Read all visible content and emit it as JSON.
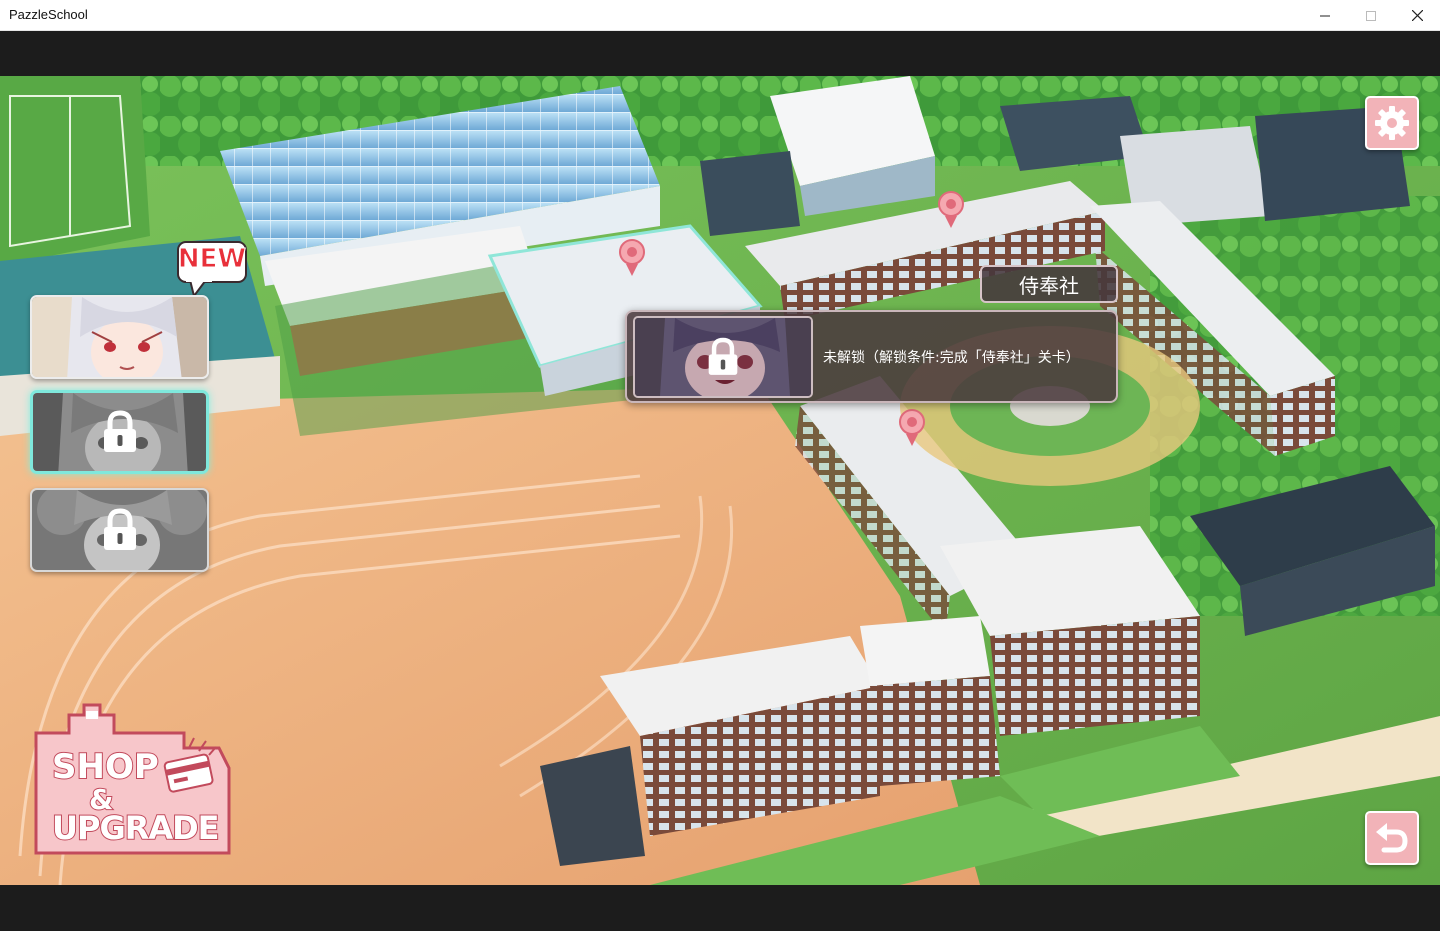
{
  "window": {
    "title": "PazzleSchool"
  },
  "characters": [
    {
      "name": "character-1",
      "locked": false
    },
    {
      "name": "character-2",
      "locked": true,
      "selected": true
    },
    {
      "name": "character-3",
      "locked": true
    }
  ],
  "new_badge": "NEW",
  "selected_location": {
    "name": "侍奉社",
    "status_message": "未解锁（解锁条件:完成「侍奉社」关卡）"
  },
  "shop_button": {
    "line1": "SHOP",
    "line2": "&",
    "line3": "UPGRADE"
  },
  "icons": {
    "settings": "gear-icon",
    "back": "return-arrow-icon",
    "lock": "padlock-icon",
    "map_marker": "map-pin-icon",
    "shop_card": "credit-card-icon"
  },
  "colors": {
    "button_pink": "#f2b3b8",
    "selection_glow": "#7fe8dc",
    "new_red": "#e8303a",
    "popup_bg": "#4b3a3e"
  }
}
